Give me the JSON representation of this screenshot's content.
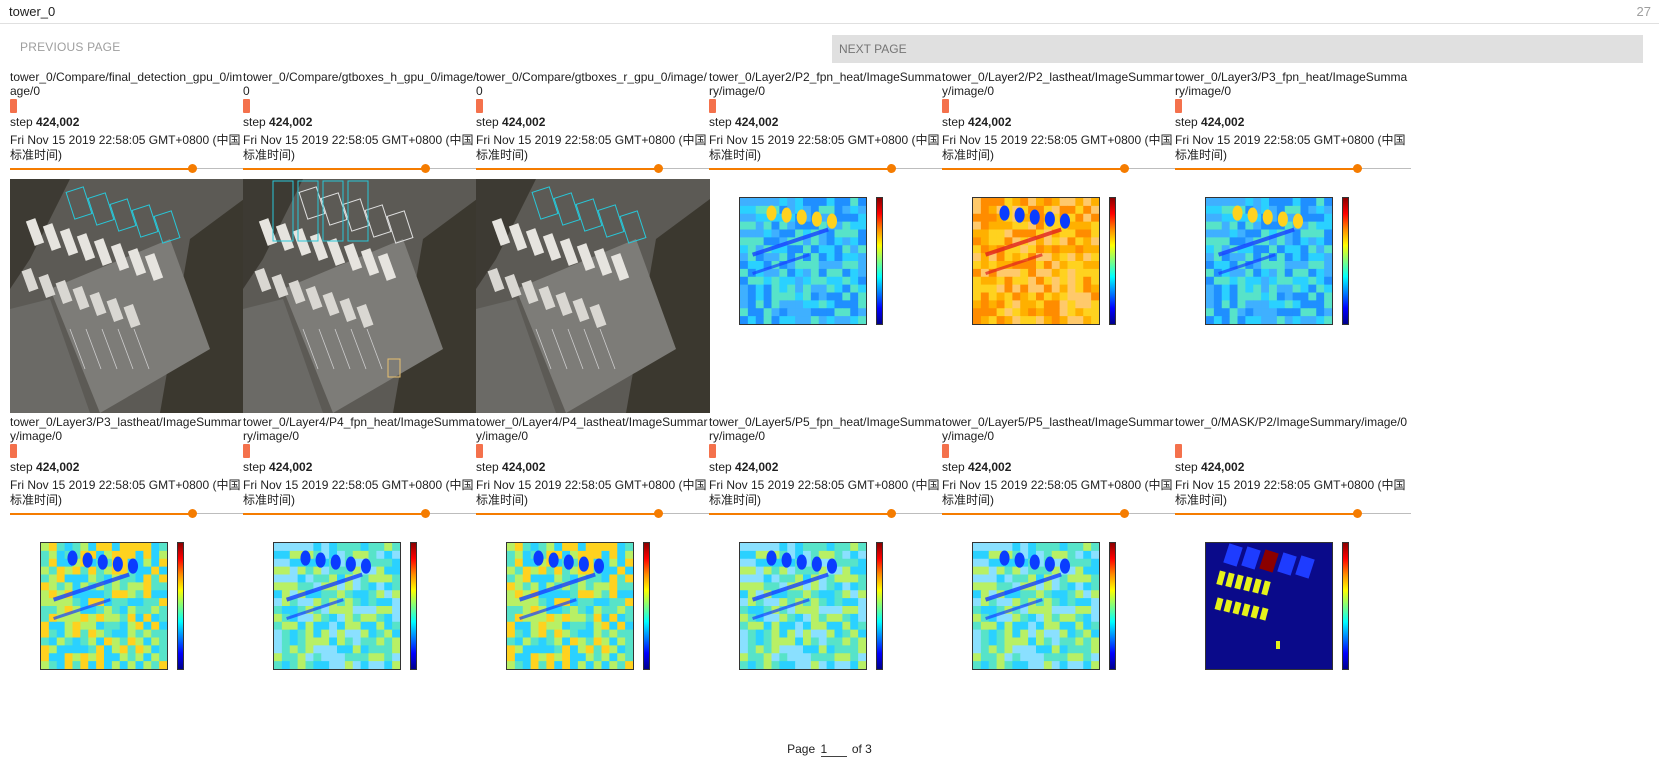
{
  "header": {
    "run_name": "tower_0",
    "image_count": "27"
  },
  "nav": {
    "prev_label": "PREVIOUS PAGE",
    "next_label": "NEXT PAGE"
  },
  "cards": [
    {
      "tag": "tower_0/Compare/final_detection_gpu_0/image/0",
      "step_label": "step",
      "step": "424,002",
      "time": "Fri Nov 15 2019 22:58:05 GMT+0800 (中国标准时间)",
      "slider_fraction": 0.77,
      "kind": "aerial"
    },
    {
      "tag": "tower_0/Compare/gtboxes_h_gpu_0/image/0",
      "step_label": "step",
      "step": "424,002",
      "time": "Fri Nov 15 2019 22:58:05 GMT+0800 (中国标准时间)",
      "slider_fraction": 0.77,
      "kind": "aerial"
    },
    {
      "tag": "tower_0/Compare/gtboxes_r_gpu_0/image/0",
      "step_label": "step",
      "step": "424,002",
      "time": "Fri Nov 15 2019 22:58:05 GMT+0800 (中国标准时间)",
      "slider_fraction": 0.77,
      "kind": "aerial"
    },
    {
      "tag": "tower_0/Layer2/P2_fpn_heat/ImageSummary/image/0",
      "step_label": "step",
      "step": "424,002",
      "time": "Fri Nov 15 2019 22:58:05 GMT+0800 (中国标准时间)",
      "slider_fraction": 0.77,
      "kind": "heat-blue"
    },
    {
      "tag": "tower_0/Layer2/P2_lastheat/ImageSummary/image/0",
      "step_label": "step",
      "step": "424,002",
      "time": "Fri Nov 15 2019 22:58:05 GMT+0800 (中国标准时间)",
      "slider_fraction": 0.77,
      "kind": "heat-orange"
    },
    {
      "tag": "tower_0/Layer3/P3_fpn_heat/ImageSummary/image/0",
      "step_label": "step",
      "step": "424,002",
      "time": "Fri Nov 15 2019 22:58:05 GMT+0800 (中国标准时间)",
      "slider_fraction": 0.77,
      "kind": "heat-blue"
    },
    {
      "tag": "tower_0/Layer3/P3_lastheat/ImageSummary/image/0",
      "step_label": "step",
      "step": "424,002",
      "time": "Fri Nov 15 2019 22:58:05 GMT+0800 (中国标准时间)",
      "slider_fraction": 0.77,
      "kind": "heat-mixed"
    },
    {
      "tag": "tower_0/Layer4/P4_fpn_heat/ImageSummary/image/0",
      "step_label": "step",
      "step": "424,002",
      "time": "Fri Nov 15 2019 22:58:05 GMT+0800 (中国标准时间)",
      "slider_fraction": 0.77,
      "kind": "heat-cyan"
    },
    {
      "tag": "tower_0/Layer4/P4_lastheat/ImageSummary/image/0",
      "step_label": "step",
      "step": "424,002",
      "time": "Fri Nov 15 2019 22:58:05 GMT+0800 (中国标准时间)",
      "slider_fraction": 0.77,
      "kind": "heat-mixed"
    },
    {
      "tag": "tower_0/Layer5/P5_fpn_heat/ImageSummary/image/0",
      "step_label": "step",
      "step": "424,002",
      "time": "Fri Nov 15 2019 22:58:05 GMT+0800 (中国标准时间)",
      "slider_fraction": 0.77,
      "kind": "heat-cyan"
    },
    {
      "tag": "tower_0/Layer5/P5_lastheat/ImageSummary/image/0",
      "step_label": "step",
      "step": "424,002",
      "time": "Fri Nov 15 2019 22:58:05 GMT+0800 (中国标准时间)",
      "slider_fraction": 0.77,
      "kind": "heat-cyan"
    },
    {
      "tag": "tower_0/MASK/P2/ImageSummary/image/0",
      "step_label": "step",
      "step": "424,002",
      "time": "Fri Nov 15 2019 22:58:05 GMT+0800 (中国标准时间)",
      "slider_fraction": 0.77,
      "kind": "mask"
    }
  ],
  "pagination": {
    "prefix": "Page",
    "current": "1",
    "suffix": "of 3"
  },
  "colors": {
    "accent": "#f57c00",
    "run_chip": "#f4714c",
    "next_bg": "#e0e0e0"
  }
}
